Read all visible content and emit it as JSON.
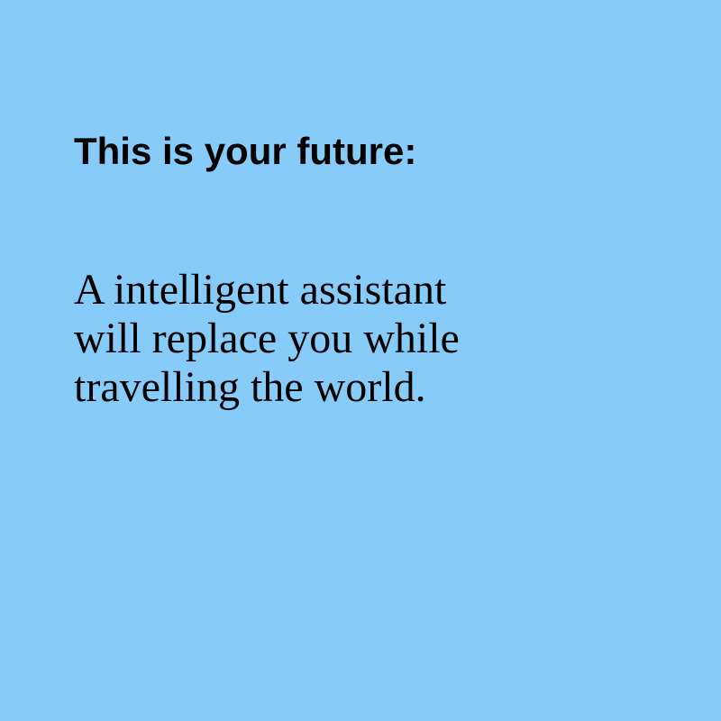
{
  "background_color": "#87CBF8",
  "text_color": "#000000",
  "heading": "This is your future:",
  "body_lines": [
    "A intelligent assistant",
    "will replace you while",
    "travelling the world."
  ]
}
